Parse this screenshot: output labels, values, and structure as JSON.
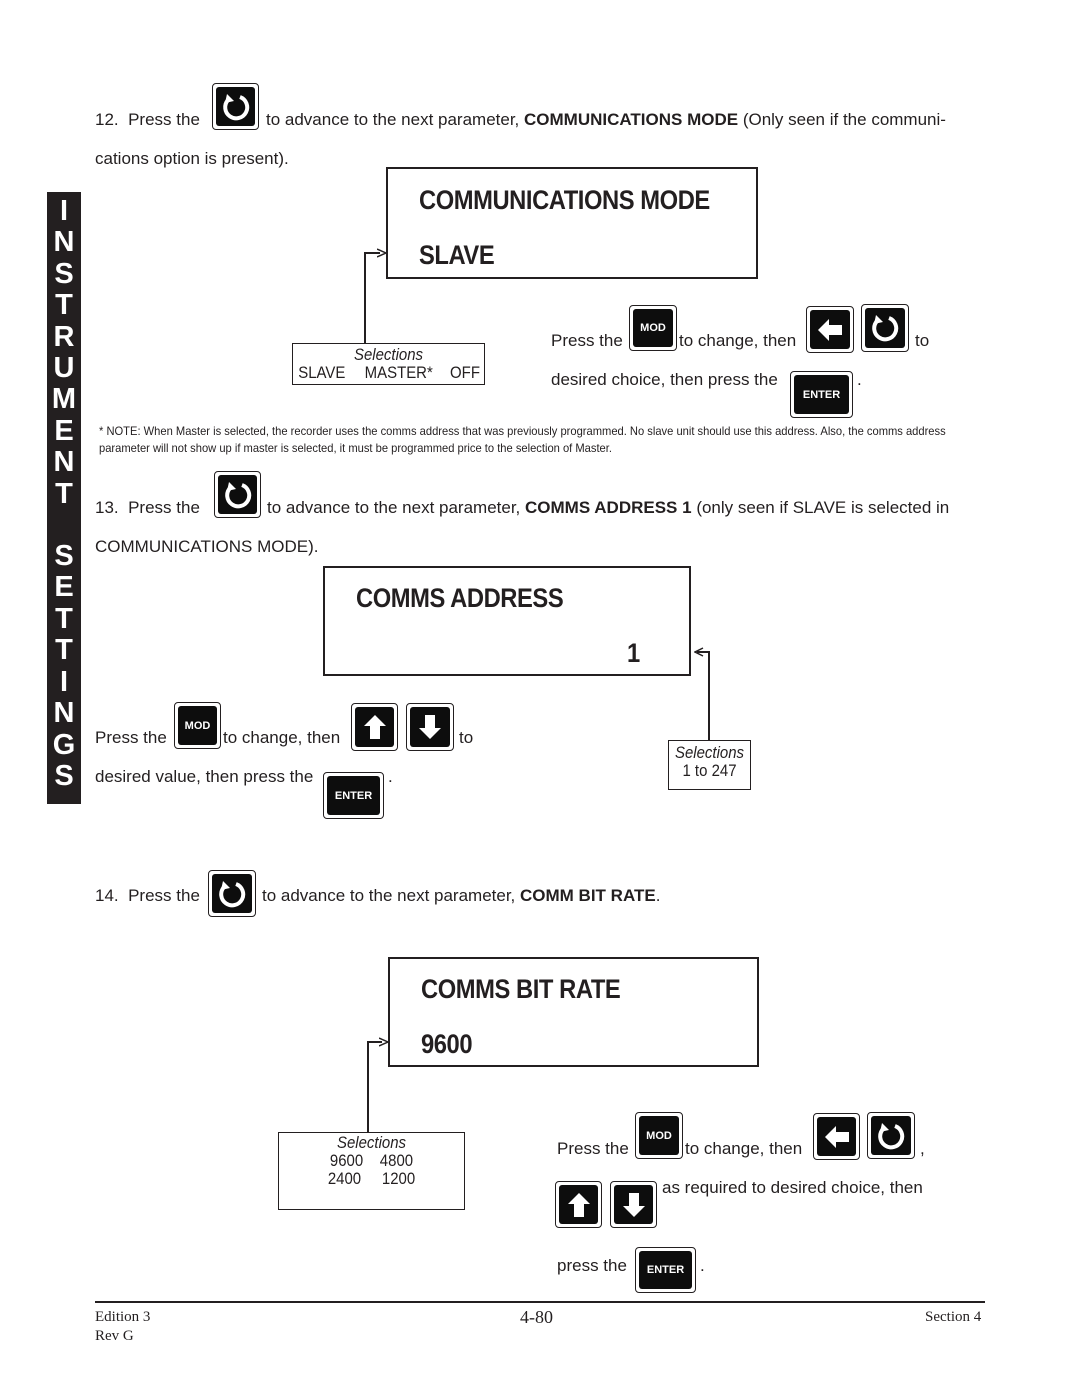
{
  "side_tab": {
    "letters": [
      "I",
      "N",
      "S",
      "T",
      "R",
      "U",
      "M",
      "E",
      "N",
      "T",
      "",
      "S",
      "E",
      "T",
      "T",
      "I",
      "N",
      "G",
      "S"
    ],
    "label": "INSTRUMENT SETTINGS"
  },
  "keys": {
    "mod": "MOD",
    "enter": "ENTER"
  },
  "step12": {
    "number": "12.",
    "press_the": "Press the",
    "text_a": "to advance to the next parameter,",
    "param": "COMMUNICATIONS MODE",
    "text_b": "(Only seen if the communi-",
    "text_c": "cations option is present).",
    "display": {
      "line1": "COMMUNICATIONS  MODE",
      "line2": "SLAVE"
    },
    "selections": {
      "title": "Selections",
      "options": [
        "SLAVE",
        "MASTER*",
        "OFF"
      ]
    },
    "instr": {
      "press_the": "Press the",
      "to_change_then": "to change, then",
      "to": "to",
      "line2": "desired choice, then press the",
      "period": "."
    },
    "note_line1": "*  NOTE: When Master is selected, the recorder uses the comms address that was previously programmed.  No slave unit should use this address.  Also, the comms address",
    "note_line2": "parameter will not show up if master is selected, it must be programmed price to the selection of Master."
  },
  "step13": {
    "number": "13.",
    "press_the": "Press the",
    "text_a": "to advance to the next parameter,",
    "param": "COMMS ADDRESS 1",
    "text_b": "(only seen if SLAVE is selected in",
    "text_c": "COMMUNICATIONS MODE).",
    "display": {
      "line1": "COMMS  ADDRESS",
      "value": "1"
    },
    "selections": {
      "title": "Selections",
      "range": "1 to 247"
    },
    "instr": {
      "press_the": "Press the",
      "to_change_then": "to change, then",
      "to": "to",
      "line2": "desired value, then press the",
      "period": "."
    }
  },
  "step14": {
    "number": "14.",
    "press_the": "Press the",
    "text_a": "to advance to the next parameter,",
    "param": "COMM BIT RATE",
    "period": ".",
    "display": {
      "line1": "COMMS  BIT  RATE",
      "line2": "9600"
    },
    "selections": {
      "title": "Selections",
      "row1": "9600    4800",
      "row2": "2400     1200"
    },
    "instr": {
      "press_the": "Press the",
      "to_change_then": "to change, then",
      "comma": ",",
      "line2": "as required to desired choice, then",
      "line3": "press  the",
      "period": "."
    }
  },
  "footer": {
    "edition": "Edition 3",
    "rev": "Rev G",
    "page": "4-80",
    "section": "Section 4"
  }
}
